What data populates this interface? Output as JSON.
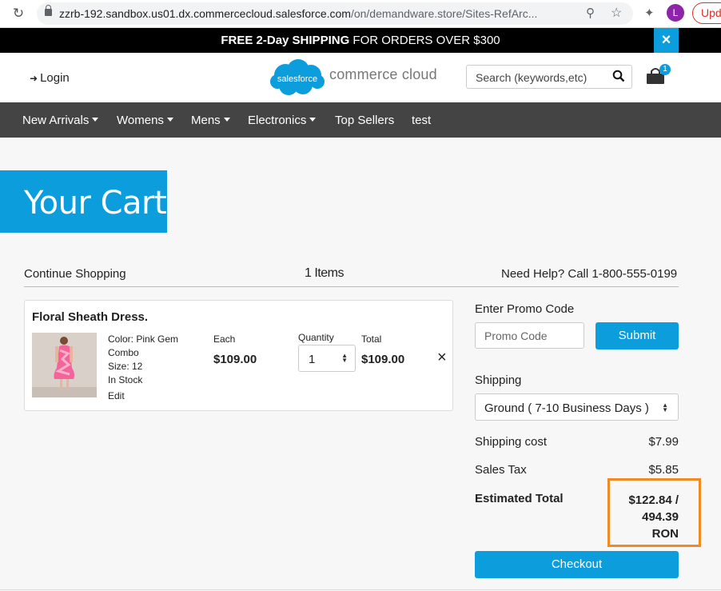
{
  "browser": {
    "url_domain": "zzrb-192.sandbox.us01.dx.commercecloud.salesforce.com",
    "url_path": "/on/demandware.store/Sites-RefArc...",
    "avatar_letter": "L",
    "update_label": "Upd"
  },
  "banner": {
    "strong_text": "FREE 2-Day SHIPPING",
    "rest_text": " FOR ORDERS OVER $300",
    "close_icon": "×"
  },
  "header": {
    "login_label": "Login",
    "logo_cloud_text": "salesforce",
    "logo_text": "commerce cloud",
    "search_placeholder": "Search (keywords,etc)",
    "cart_count": "1"
  },
  "nav": {
    "items": [
      {
        "label": "New Arrivals",
        "has_menu": true
      },
      {
        "label": "Womens",
        "has_menu": true
      },
      {
        "label": "Mens",
        "has_menu": true
      },
      {
        "label": "Electronics",
        "has_menu": true
      },
      {
        "label": "Top Sellers",
        "has_menu": false
      },
      {
        "label": "test",
        "has_menu": false
      }
    ]
  },
  "page": {
    "title": "Your Cart",
    "continue_label": "Continue Shopping",
    "item_count": "1 Items",
    "help_text": "Need Help? Call 1-800-555-0199"
  },
  "product": {
    "name": "Floral Sheath Dress.",
    "color_line1": "Color: Pink Gem",
    "color_line2": "Combo",
    "size": "Size: 12",
    "stock": "In Stock",
    "edit_label": "Edit",
    "each_label": "Each",
    "each_price": "$109.00",
    "quantity_label": "Quantity",
    "quantity_value": "1",
    "total_label": "Total",
    "total_price": "$109.00",
    "remove_icon": "×"
  },
  "summary": {
    "promo_label": "Enter Promo Code",
    "promo_placeholder": "Promo Code",
    "submit_label": "Submit",
    "shipping_label": "Shipping",
    "shipping_method": "Ground ( 7-10 Business Days )",
    "shipping_cost_label": "Shipping cost",
    "shipping_cost": "$7.99",
    "sales_tax_label": "Sales Tax",
    "sales_tax": "$5.85",
    "estimated_total_label": "Estimated Total",
    "estimated_total_line1": "$122.84 /",
    "estimated_total_line2": "494.39",
    "estimated_total_line3": "RON",
    "checkout_label": "Checkout"
  },
  "colors": {
    "accent_blue": "#0c9ddc",
    "nav_bg": "#444444",
    "highlight_orange": "#f08a24"
  }
}
